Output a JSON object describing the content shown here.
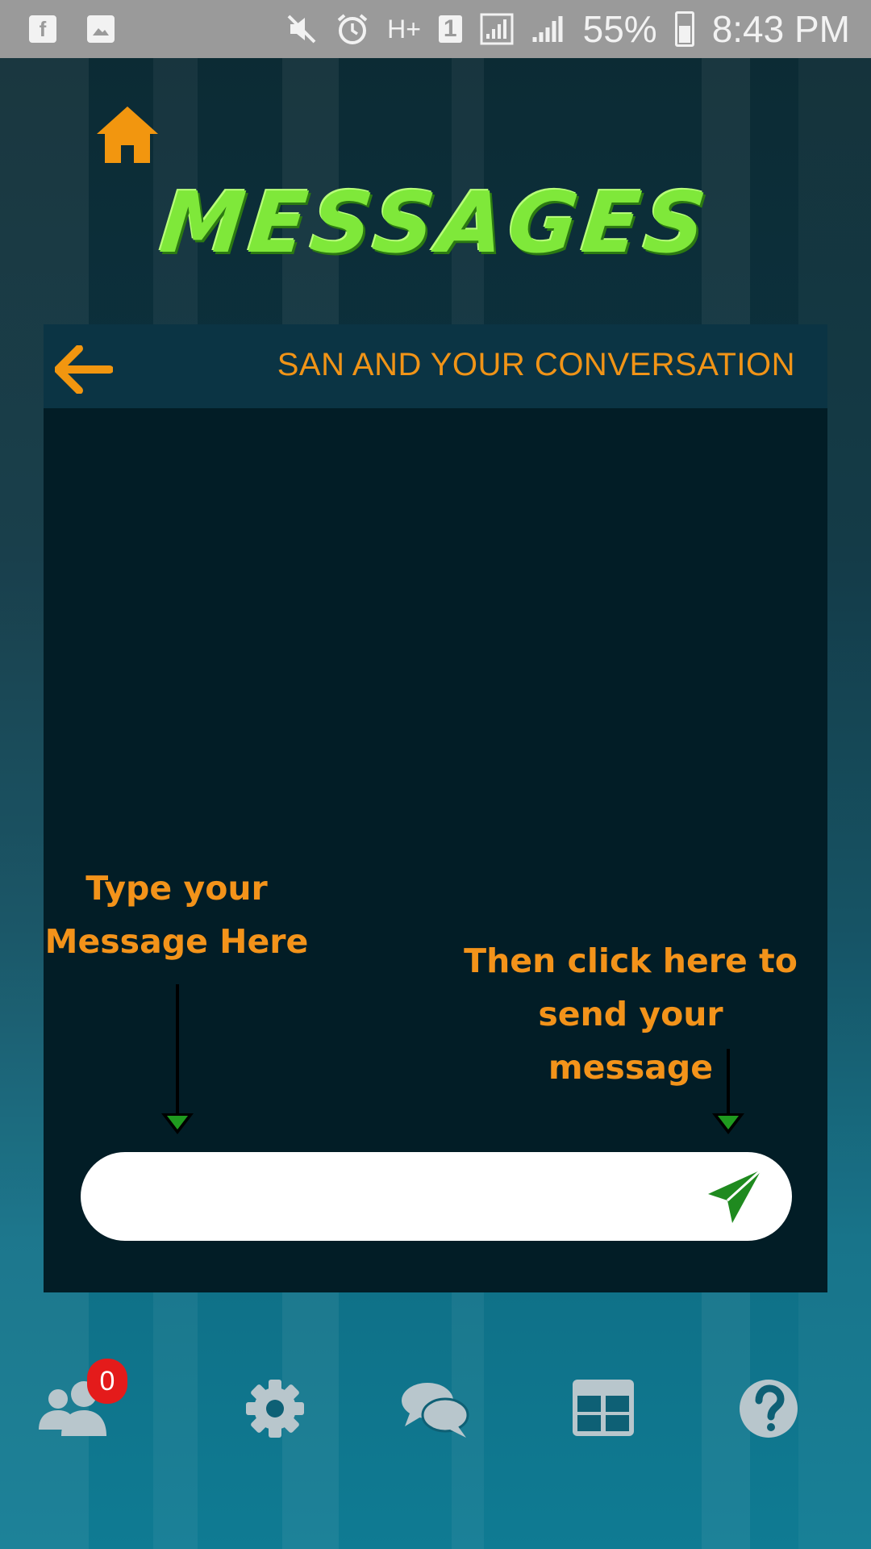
{
  "status_bar": {
    "battery_percent": "55%",
    "time": "8:43 PM",
    "network_type": "H+",
    "sim_slot": "1",
    "icons": [
      "facebook-icon",
      "gallery-icon",
      "mute-icon",
      "alarm-icon",
      "network-icon",
      "signal-icon",
      "battery-icon"
    ]
  },
  "header": {
    "title": "MESSAGES",
    "home_icon": "home-icon"
  },
  "conversation": {
    "title": "SAN AND YOUR CONVERSATION",
    "back_icon": "back-arrow-icon"
  },
  "hints": {
    "type_line1": "Type your",
    "type_line2": "Message Here",
    "send_line1": "Then click here to",
    "send_line2": "send your message"
  },
  "composer": {
    "value": "",
    "placeholder": "",
    "send_icon": "send-icon"
  },
  "bottom_nav": {
    "items": [
      {
        "icon": "friends-icon",
        "badge": "0"
      },
      {
        "icon": "settings-icon"
      },
      {
        "icon": "chat-icon"
      },
      {
        "icon": "grid-icon"
      },
      {
        "icon": "help-icon"
      }
    ]
  },
  "colors": {
    "accent_orange": "#f19417",
    "title_green": "#7fe83a",
    "panel_bg": "#021d26",
    "badge_red": "#e41b1b",
    "send_green": "#1f8a1f"
  }
}
